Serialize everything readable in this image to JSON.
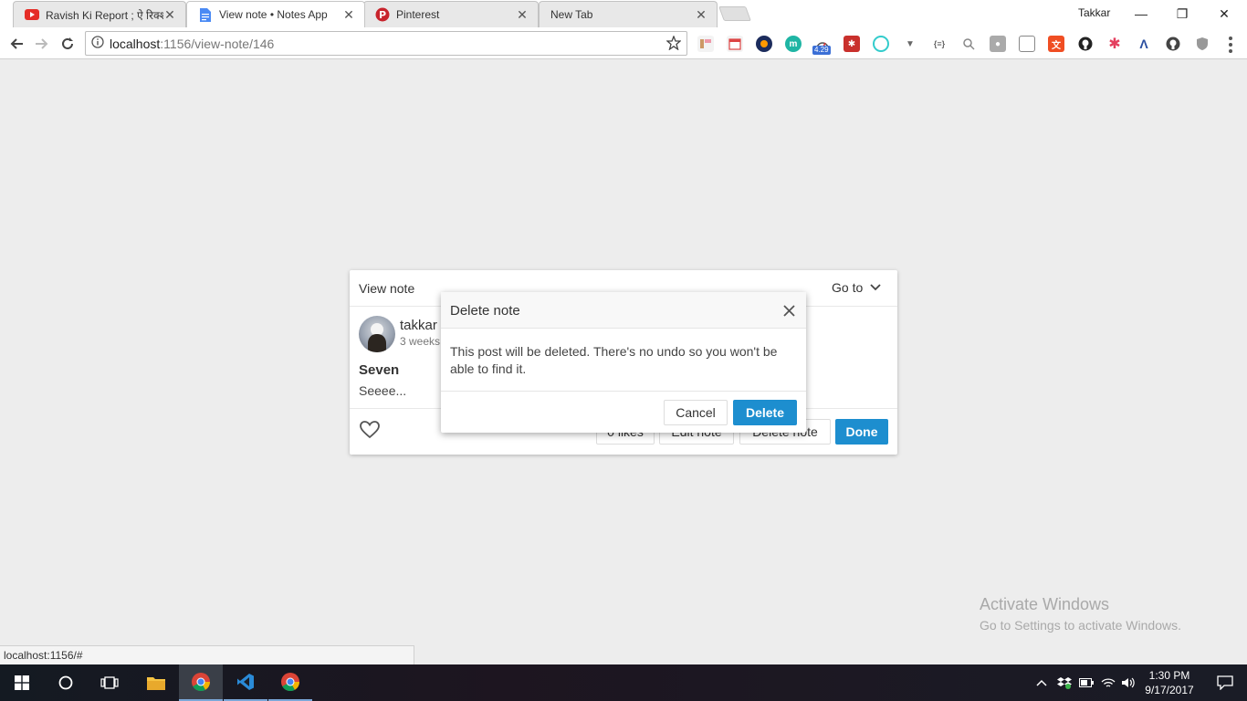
{
  "browser": {
    "tabs": [
      {
        "title": "Ravish Ki Report ; ऐ रिक्शा",
        "favicon": "youtube-icon",
        "active": false
      },
      {
        "title": "View note • Notes App",
        "favicon": "document-icon",
        "active": true
      },
      {
        "title": "Pinterest",
        "favicon": "pinterest-icon",
        "active": false
      },
      {
        "title": "New Tab",
        "favicon": "",
        "active": false
      }
    ],
    "profile_name": "Takkar",
    "url_host": "localhost",
    "url_path": ":1156/view-note/146",
    "extension_badge": "4.29"
  },
  "card": {
    "title": "View note",
    "goto_label": "Go to",
    "username": "takkar",
    "timestamp": "3 weeks",
    "note_title": "Seven",
    "note_body": "Seeee...",
    "likes_label": "0 likes",
    "edit_label": "Edit note",
    "delete_label": "Delete note",
    "done_label": "Done"
  },
  "modal": {
    "title": "Delete note",
    "body": "This post will be deleted. There's no undo so you won't be able to find it.",
    "cancel_label": "Cancel",
    "delete_label": "Delete"
  },
  "watermark": {
    "title": "Activate Windows",
    "subtitle": "Go to Settings to activate Windows."
  },
  "status_url": "localhost:1156/#",
  "taskbar": {
    "time": "1:30 PM",
    "date": "9/17/2017"
  },
  "colors": {
    "accent": "#1d8ecf",
    "page_background": "#ededed"
  }
}
